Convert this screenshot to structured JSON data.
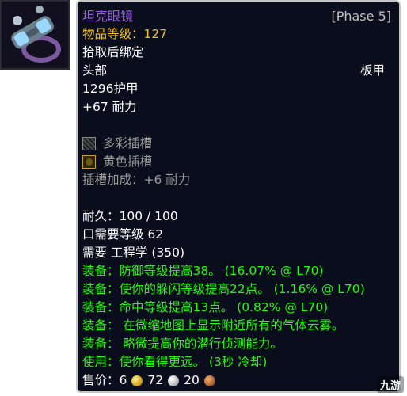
{
  "item": {
    "icon": "goggles-icon",
    "name": "坦克眼镜",
    "phase": "[Phase 5]",
    "item_level": "物品等级：127",
    "binding": "拾取后绑定",
    "slot": "头部",
    "armor_type": "板甲",
    "armor": "1296护甲",
    "stat_stamina": "+67 耐力",
    "sockets": [
      {
        "icon": "prismatic-socket-icon",
        "label": "多彩插槽"
      },
      {
        "icon": "yellow-socket-icon",
        "label": "黄色插槽"
      }
    ],
    "socket_bonus": "插槽加成：+6 耐力",
    "durability": "耐久：100 / 100",
    "level_req": "口需要等级 62",
    "prof_req": "需要 工程学 (350)",
    "effects": [
      "装备：防御等级提高38。 (16.07% @ L70)",
      "装备：使你的躲闪等级提高22点。 (1.16% @ L70)",
      "装备：命中等级提高13点。 (0.82% @ L70)",
      "装备： 在微缩地图上显示附近所有的气体云雾。",
      "装备： 略微提高你的潜行侦测能力。",
      "使用：使你看得更远。 (3秒 冷却)"
    ],
    "sell_label": "售价：",
    "sell_gold": "6",
    "sell_silver": "72",
    "sell_copper": "20"
  },
  "watermark": "九游",
  "colors": {
    "epic": "#9d5cf0",
    "item_level": "#f0c21a",
    "green_effect": "#1eff00",
    "socket_text": "#9b9b9b"
  }
}
